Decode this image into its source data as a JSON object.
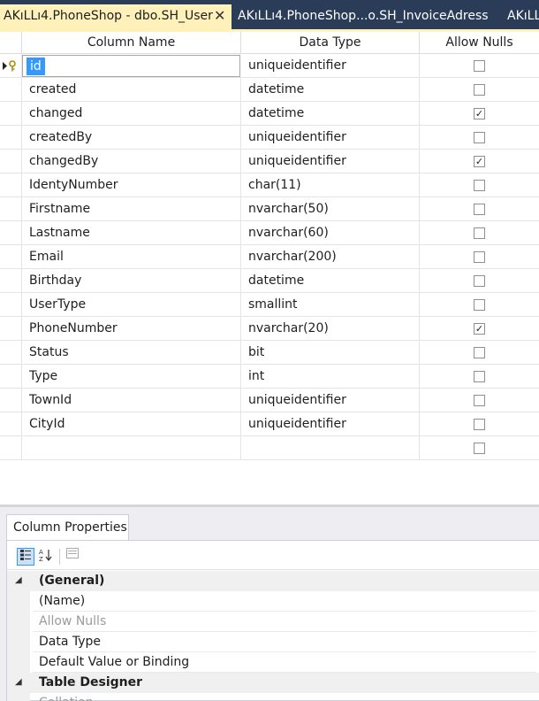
{
  "tabs": [
    {
      "label": "AKıLLı4.PhoneShop - dbo.SH_User",
      "close": "✕"
    },
    {
      "label": "AKıLLı4.PhoneShop...o.SH_InvoiceAdress"
    },
    {
      "label": "AKıLL"
    }
  ],
  "grid": {
    "headers": {
      "name": "Column Name",
      "type": "Data Type",
      "nulls": "Allow Nulls"
    },
    "rows": [
      {
        "name": "id",
        "type": "uniqueidentifier",
        "nulls": "",
        "selected": true,
        "primary_key": true
      },
      {
        "name": "created",
        "type": "datetime",
        "nulls": ""
      },
      {
        "name": "changed",
        "type": "datetime",
        "nulls": "✓"
      },
      {
        "name": "createdBy",
        "type": "uniqueidentifier",
        "nulls": ""
      },
      {
        "name": "changedBy",
        "type": "uniqueidentifier",
        "nulls": "✓"
      },
      {
        "name": "IdentyNumber",
        "type": "char(11)",
        "nulls": ""
      },
      {
        "name": "Firstname",
        "type": "nvarchar(50)",
        "nulls": ""
      },
      {
        "name": "Lastname",
        "type": "nvarchar(60)",
        "nulls": ""
      },
      {
        "name": "Email",
        "type": "nvarchar(200)",
        "nulls": ""
      },
      {
        "name": "Birthday",
        "type": "datetime",
        "nulls": ""
      },
      {
        "name": "UserType",
        "type": "smallint",
        "nulls": ""
      },
      {
        "name": "PhoneNumber",
        "type": "nvarchar(20)",
        "nulls": "✓"
      },
      {
        "name": "Status",
        "type": "bit",
        "nulls": ""
      },
      {
        "name": "Type",
        "type": "int",
        "nulls": ""
      },
      {
        "name": "TownId",
        "type": "uniqueidentifier",
        "nulls": ""
      },
      {
        "name": "CityId",
        "type": "uniqueidentifier",
        "nulls": ""
      },
      {
        "name": "",
        "type": "",
        "nulls": ""
      }
    ]
  },
  "properties": {
    "tab_label": "Column Properties",
    "toolbar": {
      "categorized_icon": "categorized-icon",
      "alphabetical_icon": "alphabetical-sort-icon",
      "property_pages_icon": "property-pages-icon"
    },
    "sections": [
      {
        "title": "(General)",
        "collapse": "◢",
        "items": [
          {
            "label": "(Name)",
            "disabled": false
          },
          {
            "label": "Allow Nulls",
            "disabled": true
          },
          {
            "label": "Data Type",
            "disabled": false
          },
          {
            "label": "Default Value or Binding",
            "disabled": false
          }
        ]
      },
      {
        "title": "Table Designer",
        "collapse": "◢",
        "items": [
          {
            "label": "Collation",
            "disabled": true
          }
        ]
      }
    ]
  },
  "colors": {
    "tab_bar": "#2b3c59",
    "active_tab": "#fff1b9",
    "selection": "#3399ff"
  }
}
